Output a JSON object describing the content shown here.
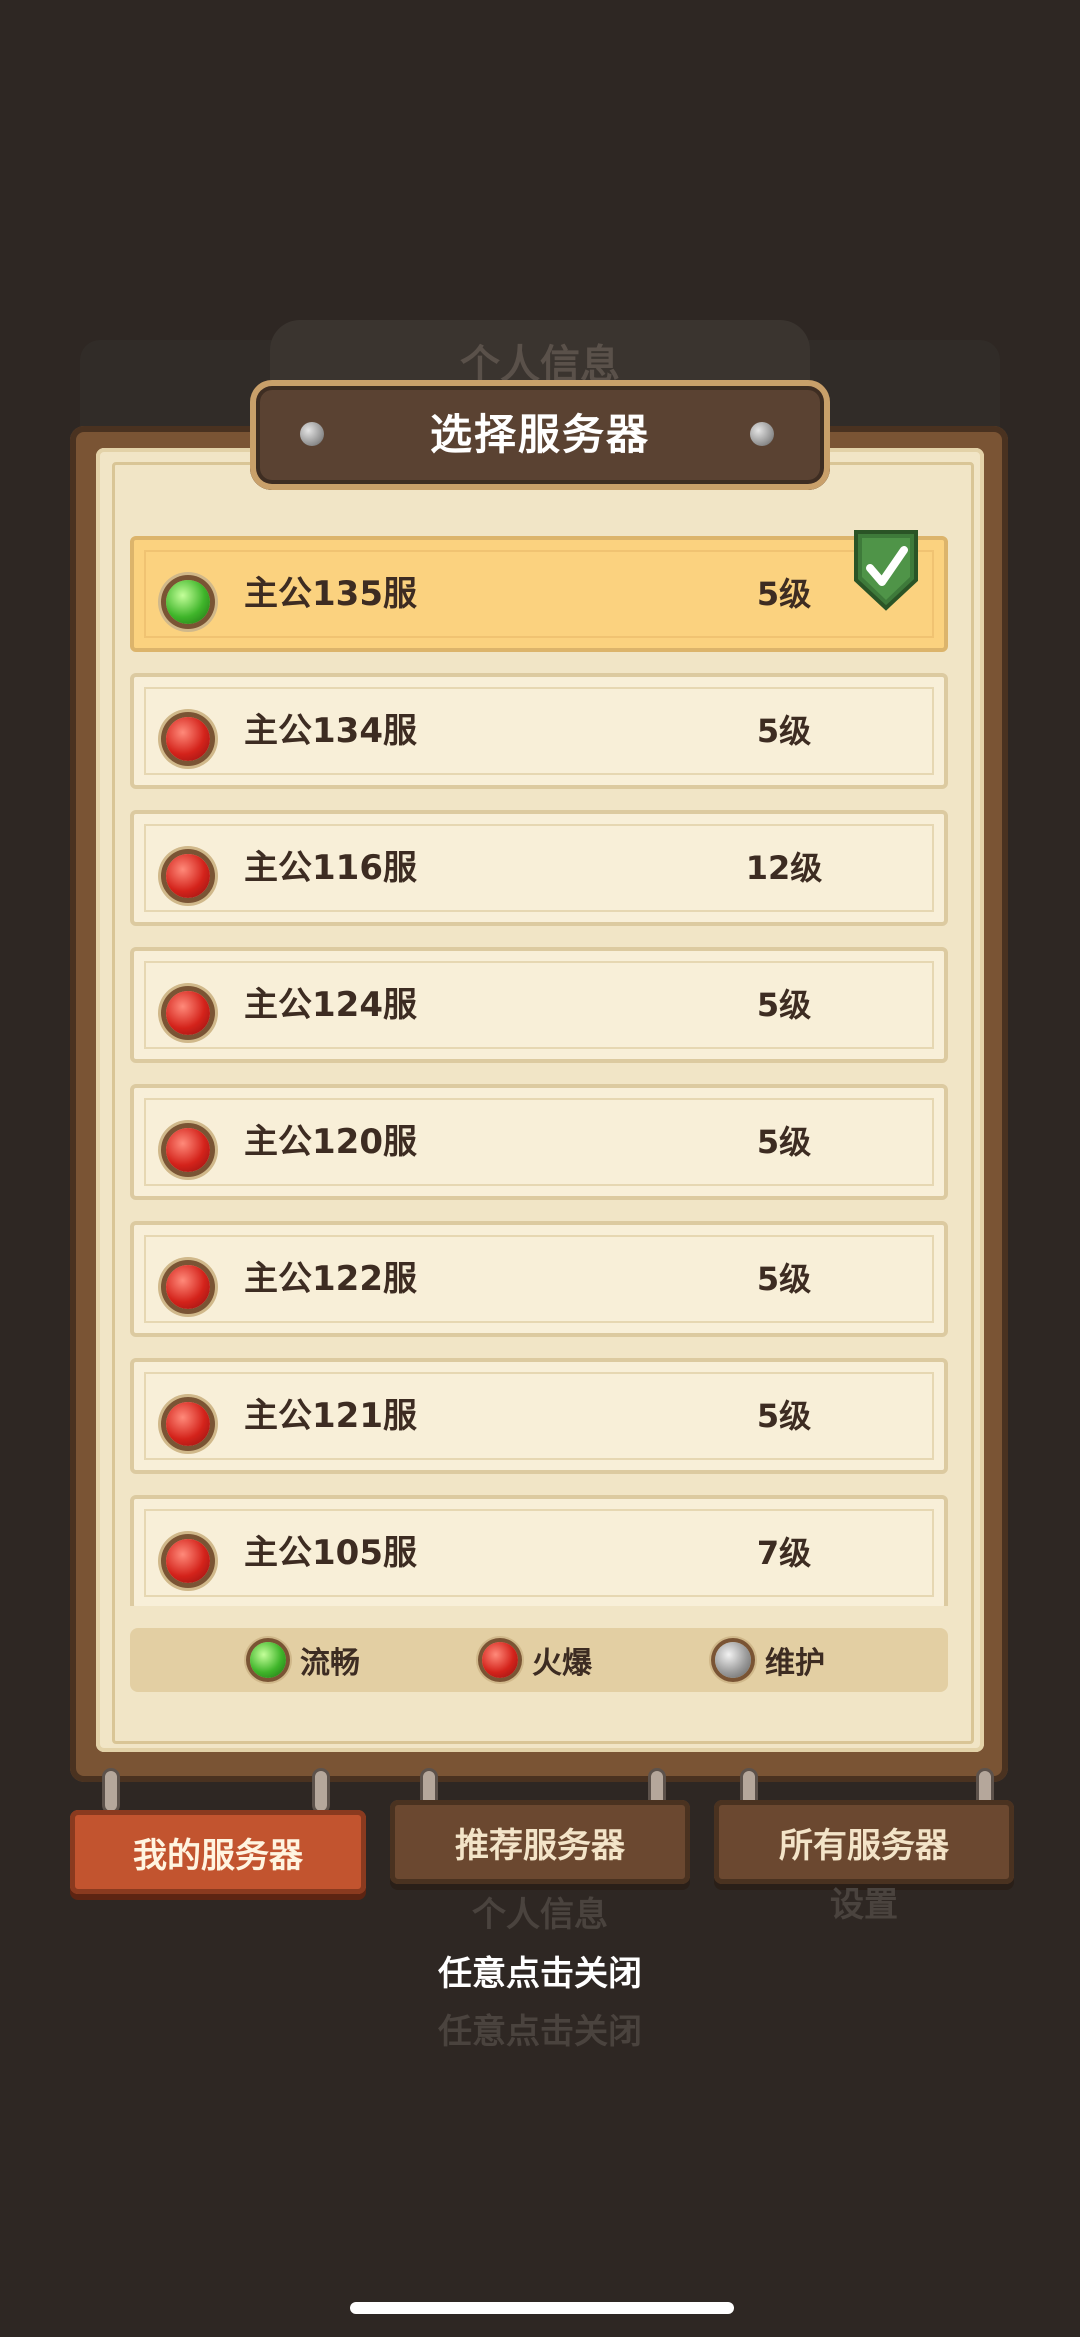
{
  "ghost": {
    "title": "个人信息",
    "bottom_tab": "个人信息",
    "bottom_right": "设置",
    "hint": "任意点击关闭"
  },
  "dialog": {
    "title": "选择服务器"
  },
  "servers": [
    {
      "name": "主公135服",
      "level": "5级",
      "status": "green",
      "selected": true
    },
    {
      "name": "主公134服",
      "level": "5级",
      "status": "red"
    },
    {
      "name": "主公116服",
      "level": "12级",
      "status": "red"
    },
    {
      "name": "主公124服",
      "level": "5级",
      "status": "red"
    },
    {
      "name": "主公120服",
      "level": "5级",
      "status": "red"
    },
    {
      "name": "主公122服",
      "level": "5级",
      "status": "red"
    },
    {
      "name": "主公121服",
      "level": "5级",
      "status": "red"
    },
    {
      "name": "主公105服",
      "level": "7级",
      "status": "red"
    }
  ],
  "legend": [
    {
      "label": "流畅",
      "color": "green"
    },
    {
      "label": "火爆",
      "color": "red"
    },
    {
      "label": "维护",
      "color": "gray"
    }
  ],
  "tabs": [
    {
      "label": "我的服务器",
      "active": true
    },
    {
      "label": "推荐服务器",
      "active": false
    },
    {
      "label": "所有服务器",
      "active": false
    }
  ],
  "close_hint": "任意点击关闭"
}
